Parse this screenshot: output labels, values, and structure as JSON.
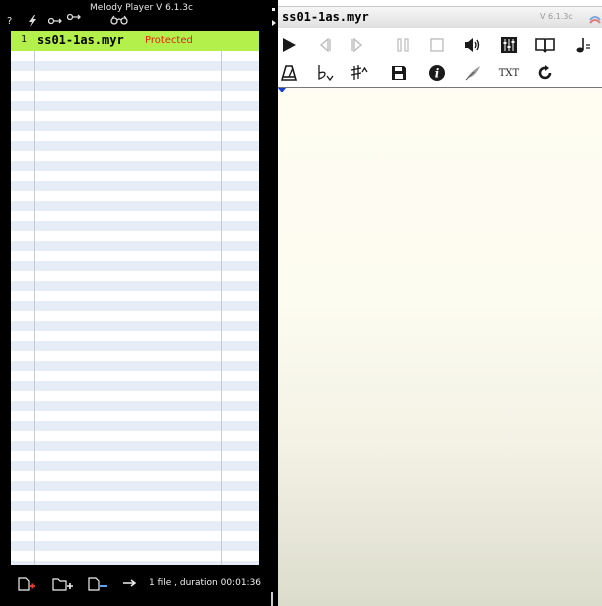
{
  "app": {
    "title": "Melody Player V 6.1.3c"
  },
  "left_toolbar": {
    "icons": [
      {
        "name": "help-icon",
        "glyph": "?"
      },
      {
        "name": "lightning-icon",
        "glyph": "⚡"
      },
      {
        "name": "key-icon",
        "glyph": "o→"
      },
      {
        "name": "key-alt-icon",
        "glyph": "o→"
      },
      {
        "name": "glasses-icon",
        "glyph": "ὄ"
      }
    ]
  },
  "playlist": {
    "rows": [
      {
        "number": "1",
        "name": "ss01-1as.myr",
        "status": "Protected",
        "selected": true
      }
    ]
  },
  "footer": {
    "status": "1 file , duration 00:01:36"
  },
  "player": {
    "filename": "ss01-1as.myr",
    "version": "V 6.1.3c",
    "text_button": "TXT"
  },
  "colors": {
    "selected_row": "#b4f04b",
    "protected_text": "#e2231a",
    "row_stripe": "#e7edf6",
    "score_bg": "#fffdf2"
  }
}
